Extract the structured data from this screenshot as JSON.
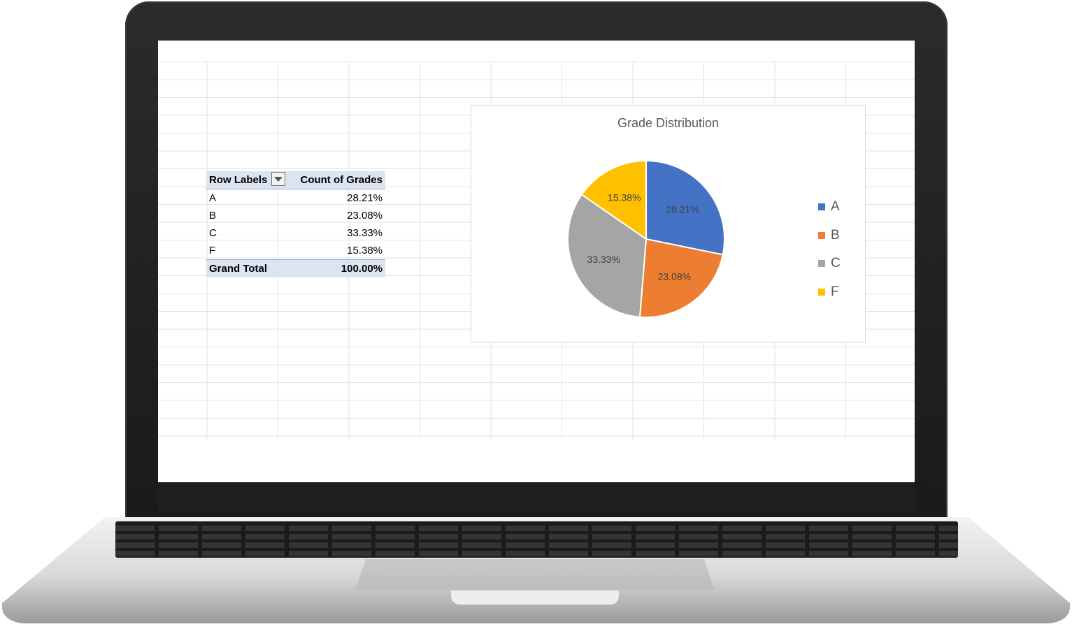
{
  "pivot": {
    "headers": {
      "row_labels": "Row Labels",
      "count": "Count of Grades"
    },
    "rows": [
      {
        "label": "A",
        "value": "28.21%"
      },
      {
        "label": "B",
        "value": "23.08%"
      },
      {
        "label": "C",
        "value": "33.33%"
      },
      {
        "label": "F",
        "value": "15.38%"
      }
    ],
    "total": {
      "label": "Grand Total",
      "value": "100.00%"
    }
  },
  "chart_data": {
    "type": "pie",
    "title": "Grade Distribution",
    "categories": [
      "A",
      "B",
      "C",
      "F"
    ],
    "values": [
      28.21,
      23.08,
      33.33,
      15.38
    ],
    "data_labels": [
      "28.21%",
      "23.08%",
      "33.33%",
      "15.38%"
    ],
    "colors": [
      "#4472c4",
      "#ed7d31",
      "#a5a5a5",
      "#ffc000"
    ],
    "legend": "right"
  }
}
